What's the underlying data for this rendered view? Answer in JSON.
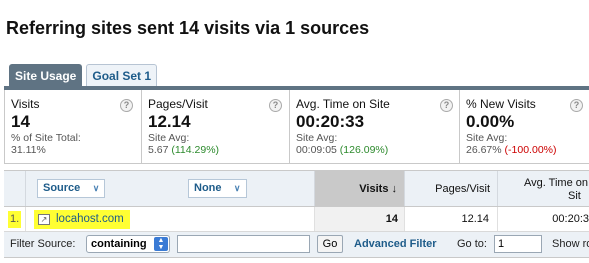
{
  "page_title": "Referring sites sent 14 visits via 1 sources",
  "tabs": [
    {
      "label": "Site Usage",
      "active": true
    },
    {
      "label": "Goal Set 1",
      "active": false
    }
  ],
  "metrics": [
    {
      "label": "Visits",
      "value": "14",
      "sub1": "% of Site Total:",
      "sub2": "31.11%",
      "sub2_delta": "",
      "help": "?"
    },
    {
      "label": "Pages/Visit",
      "value": "12.14",
      "sub1": "Site Avg:",
      "sub2": "5.67",
      "sub2_delta": "(114.29%)",
      "help": "?"
    },
    {
      "label": "Avg. Time on Site",
      "value": "00:20:33",
      "sub1": "Site Avg:",
      "sub2": "00:09:05",
      "sub2_delta": "(126.09%)",
      "help": "?"
    },
    {
      "label": "% New Visits",
      "value": "0.00%",
      "sub1": "Site Avg:",
      "sub2": "26.67%",
      "sub2_delta": "(-100.00%)",
      "help": "?"
    }
  ],
  "table": {
    "primary_dimension": "Source",
    "secondary_dimension": "None",
    "columns": {
      "visits": "Visits",
      "visits_sort_icon": "↓",
      "pages": "Pages/Visit",
      "time_line1": "Avg. Time on",
      "time_line2": "Sit"
    },
    "rows": [
      {
        "index": "1.",
        "source": "locahost.com",
        "visits": "14",
        "pages": "12.14",
        "time": "00:20:3"
      }
    ]
  },
  "filter_bar": {
    "label": "Filter Source:",
    "mode": "containing",
    "query": "",
    "go": "Go",
    "advanced": "Advanced Filter",
    "goto_label": "Go to:",
    "goto_value": "1",
    "show_rows": "Show ro"
  },
  "colors": {
    "tab_active": "#5f7383",
    "link": "#1e5c8a",
    "positive": "#2d8a2d",
    "negative": "#cc0000",
    "highlight": "#ffff33"
  }
}
